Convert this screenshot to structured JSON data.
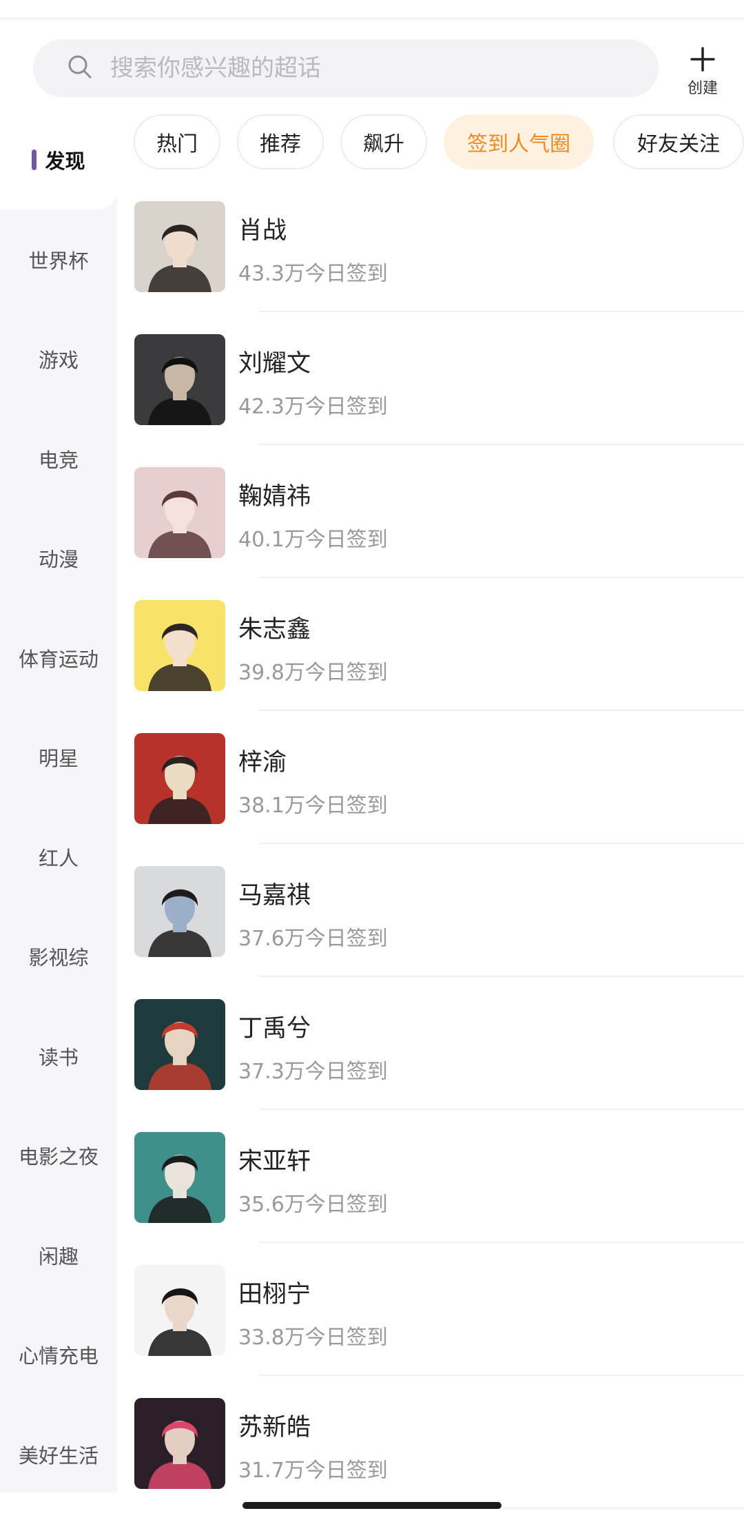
{
  "search": {
    "placeholder": "搜索你感兴趣的超话"
  },
  "create": {
    "label": "创建"
  },
  "sidebar": {
    "items": [
      {
        "label": "发现",
        "active": true
      },
      {
        "label": "世界杯"
      },
      {
        "label": "游戏"
      },
      {
        "label": "电竞"
      },
      {
        "label": "动漫"
      },
      {
        "label": "体育运动"
      },
      {
        "label": "明星"
      },
      {
        "label": "红人"
      },
      {
        "label": "影视综"
      },
      {
        "label": "读书"
      },
      {
        "label": "电影之夜"
      },
      {
        "label": "闲趣"
      },
      {
        "label": "心情充电"
      },
      {
        "label": "美好生活"
      }
    ]
  },
  "tabs": [
    {
      "label": "热门"
    },
    {
      "label": "推荐"
    },
    {
      "label": "飙升"
    },
    {
      "label": "签到人气圈",
      "active": true
    },
    {
      "label": "好友关注"
    }
  ],
  "list": [
    {
      "name": "肖战",
      "count": "43.3万今日签到",
      "colors": [
        "#d9d3cc",
        "#2a2522",
        "#f0dccc"
      ]
    },
    {
      "name": "刘耀文",
      "count": "42.3万今日签到",
      "colors": [
        "#3b3b3d",
        "#101010",
        "#c9b7a6"
      ]
    },
    {
      "name": "鞠婧祎",
      "count": "40.1万今日签到",
      "colors": [
        "#e8cfcf",
        "#5a3a3a",
        "#f5e1dc"
      ]
    },
    {
      "name": "朱志鑫",
      "count": "39.8万今日签到",
      "colors": [
        "#f7e36a",
        "#2b2623",
        "#f4dfcc"
      ]
    },
    {
      "name": "梓渝",
      "count": "38.1万今日签到",
      "colors": [
        "#b6322a",
        "#2a2220",
        "#e9dcc2"
      ]
    },
    {
      "name": "马嘉祺",
      "count": "37.6万今日签到",
      "colors": [
        "#d8dadd",
        "#1e1b1a",
        "#9ab0c8"
      ]
    },
    {
      "name": "丁禹兮",
      "count": "37.3万今日签到",
      "colors": [
        "#1f3a3a",
        "#c23d2f",
        "#e8d2c0"
      ]
    },
    {
      "name": "宋亚轩",
      "count": "35.6万今日签到",
      "colors": [
        "#3f8f8a",
        "#1c1c1c",
        "#e9e3da"
      ]
    },
    {
      "name": "田栩宁",
      "count": "33.8万今日签到",
      "colors": [
        "#f4f4f4",
        "#151515",
        "#e9d8c9"
      ]
    },
    {
      "name": "苏新皓",
      "count": "31.7万今日签到",
      "colors": [
        "#2a1e28",
        "#d9486a",
        "#e4cdc2"
      ]
    }
  ]
}
